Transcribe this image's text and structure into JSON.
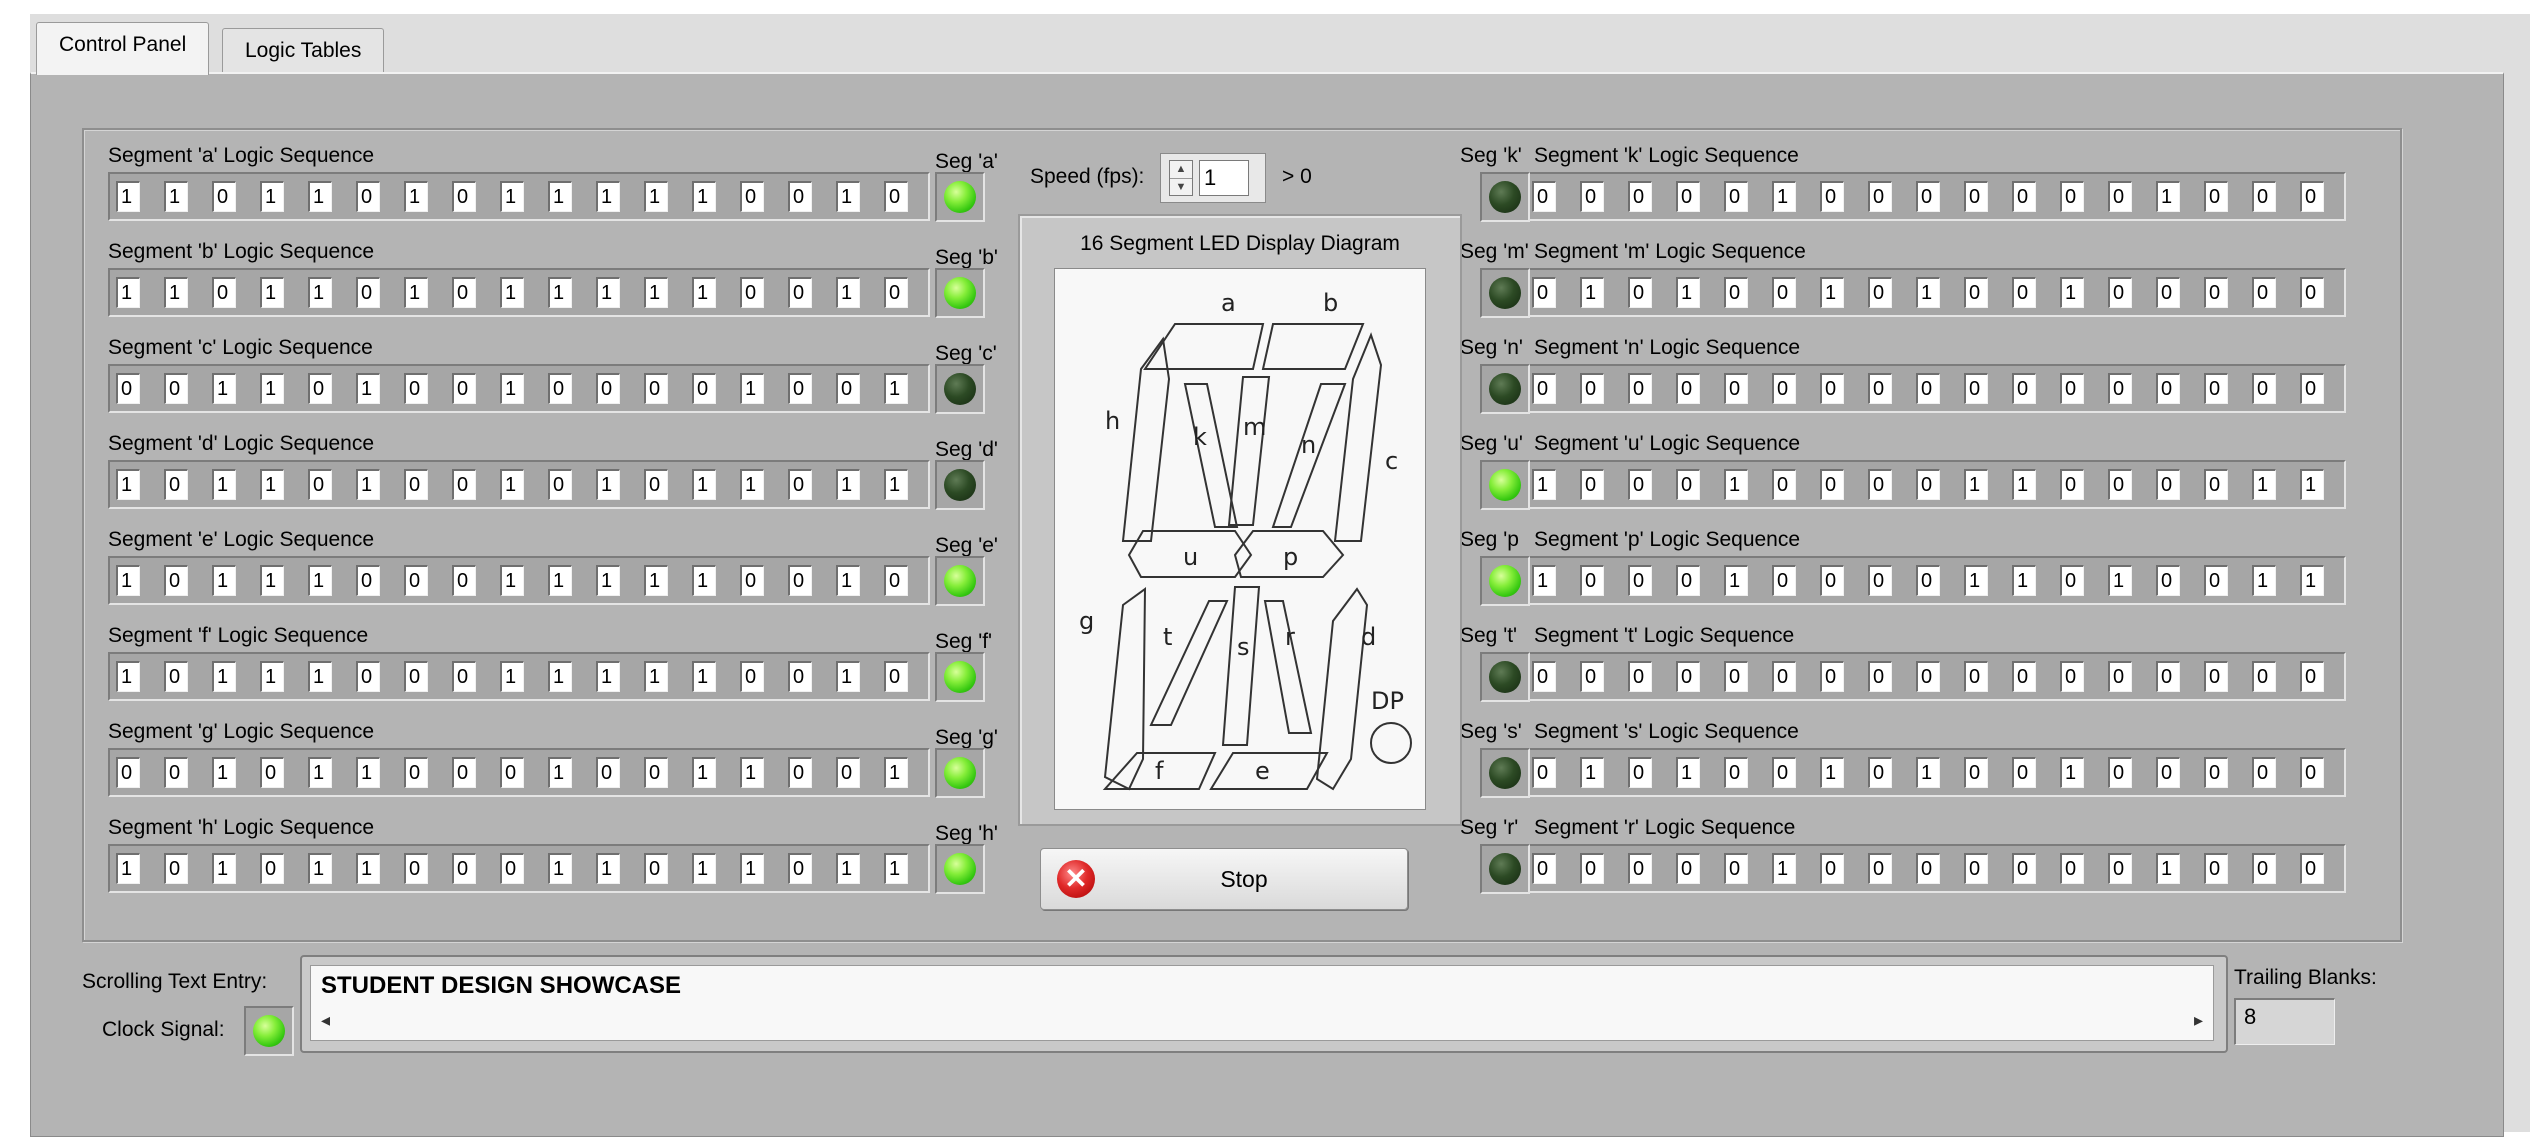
{
  "tabs": [
    "Control Panel",
    "Logic Tables"
  ],
  "speed": {
    "label": "Speed (fps):",
    "value": "1",
    "hint": "> 0"
  },
  "diagram": {
    "title": "16 Segment LED Display Diagram",
    "labels": {
      "a": "a",
      "b": "b",
      "c": "c",
      "d": "d",
      "e": "e",
      "f": "f",
      "g": "g",
      "h": "h",
      "k": "k",
      "m": "m",
      "n": "n",
      "u": "u",
      "p": "p",
      "t": "t",
      "s": "s",
      "r": "r",
      "dp": "DP"
    }
  },
  "stop_label": "Stop",
  "left_segments": [
    {
      "title": "Segment 'a' Logic Sequence",
      "led_label": "Seg 'a'",
      "led_on": true,
      "bits": [
        1,
        1,
        0,
        1,
        1,
        0,
        1,
        0,
        1,
        1,
        1,
        1,
        1,
        0,
        0,
        1,
        0
      ]
    },
    {
      "title": "Segment 'b' Logic Sequence",
      "led_label": "Seg 'b'",
      "led_on": true,
      "bits": [
        1,
        1,
        0,
        1,
        1,
        0,
        1,
        0,
        1,
        1,
        1,
        1,
        1,
        0,
        0,
        1,
        0
      ]
    },
    {
      "title": "Segment 'c' Logic Sequence",
      "led_label": "Seg 'c'",
      "led_on": false,
      "bits": [
        0,
        0,
        1,
        1,
        0,
        1,
        0,
        0,
        1,
        0,
        0,
        0,
        0,
        1,
        0,
        0,
        1
      ]
    },
    {
      "title": "Segment 'd' Logic Sequence",
      "led_label": "Seg 'd'",
      "led_on": false,
      "bits": [
        1,
        0,
        1,
        1,
        0,
        1,
        0,
        0,
        1,
        0,
        1,
        0,
        1,
        1,
        0,
        1,
        1
      ]
    },
    {
      "title": "Segment 'e' Logic Sequence",
      "led_label": "Seg 'e'",
      "led_on": true,
      "bits": [
        1,
        0,
        1,
        1,
        1,
        0,
        0,
        0,
        1,
        1,
        1,
        1,
        1,
        0,
        0,
        1,
        0
      ]
    },
    {
      "title": "Segment 'f' Logic Sequence",
      "led_label": "Seg 'f'",
      "led_on": true,
      "bits": [
        1,
        0,
        1,
        1,
        1,
        0,
        0,
        0,
        1,
        1,
        1,
        1,
        1,
        0,
        0,
        1,
        0
      ]
    },
    {
      "title": "Segment 'g' Logic Sequence",
      "led_label": "Seg 'g'",
      "led_on": true,
      "bits": [
        0,
        0,
        1,
        0,
        1,
        1,
        0,
        0,
        0,
        1,
        0,
        0,
        1,
        1,
        0,
        0,
        1
      ]
    },
    {
      "title": "Segment 'h' Logic Sequence",
      "led_label": "Seg 'h'",
      "led_on": true,
      "bits": [
        1,
        0,
        1,
        0,
        1,
        1,
        0,
        0,
        0,
        1,
        1,
        0,
        1,
        1,
        0,
        1,
        1
      ]
    }
  ],
  "right_segments": [
    {
      "title": "Segment 'k' Logic Sequence",
      "led_label": "Seg 'k'",
      "led_on": false,
      "bits": [
        0,
        0,
        0,
        0,
        0,
        1,
        0,
        0,
        0,
        0,
        0,
        0,
        0,
        1,
        0,
        0,
        0
      ]
    },
    {
      "title": "Segment 'm' Logic Sequence",
      "led_label": "Seg 'm'",
      "led_on": false,
      "bits": [
        0,
        1,
        0,
        1,
        0,
        0,
        1,
        0,
        1,
        0,
        0,
        1,
        0,
        0,
        0,
        0,
        0
      ]
    },
    {
      "title": "Segment 'n' Logic Sequence",
      "led_label": "Seg 'n'",
      "led_on": false,
      "bits": [
        0,
        0,
        0,
        0,
        0,
        0,
        0,
        0,
        0,
        0,
        0,
        0,
        0,
        0,
        0,
        0,
        0
      ]
    },
    {
      "title": "Segment 'u' Logic Sequence",
      "led_label": "Seg 'u'",
      "led_on": true,
      "bits": [
        1,
        0,
        0,
        0,
        1,
        0,
        0,
        0,
        0,
        1,
        1,
        0,
        0,
        0,
        0,
        1,
        1
      ]
    },
    {
      "title": "Segment 'p' Logic Sequence",
      "led_label": "Seg 'p",
      "led_on": true,
      "bits": [
        1,
        0,
        0,
        0,
        1,
        0,
        0,
        0,
        0,
        1,
        1,
        0,
        1,
        0,
        0,
        1,
        1
      ]
    },
    {
      "title": "Segment 't' Logic Sequence",
      "led_label": "Seg 't'",
      "led_on": false,
      "bits": [
        0,
        0,
        0,
        0,
        0,
        0,
        0,
        0,
        0,
        0,
        0,
        0,
        0,
        0,
        0,
        0,
        0
      ]
    },
    {
      "title": "Segment 's' Logic Sequence",
      "led_label": "Seg 's'",
      "led_on": false,
      "bits": [
        0,
        1,
        0,
        1,
        0,
        0,
        1,
        0,
        1,
        0,
        0,
        1,
        0,
        0,
        0,
        0,
        0
      ]
    },
    {
      "title": "Segment 'r' Logic Sequence",
      "led_label": "Seg 'r'",
      "led_on": false,
      "bits": [
        0,
        0,
        0,
        0,
        0,
        1,
        0,
        0,
        0,
        0,
        0,
        0,
        0,
        1,
        0,
        0,
        0
      ]
    }
  ],
  "scrolling_text": {
    "label": "Scrolling Text Entry:",
    "value": "STUDENT DESIGN SHOWCASE"
  },
  "clock": {
    "label": "Clock Signal:",
    "led_on": true
  },
  "trailing": {
    "label": "Trailing Blanks:",
    "value": "8"
  }
}
